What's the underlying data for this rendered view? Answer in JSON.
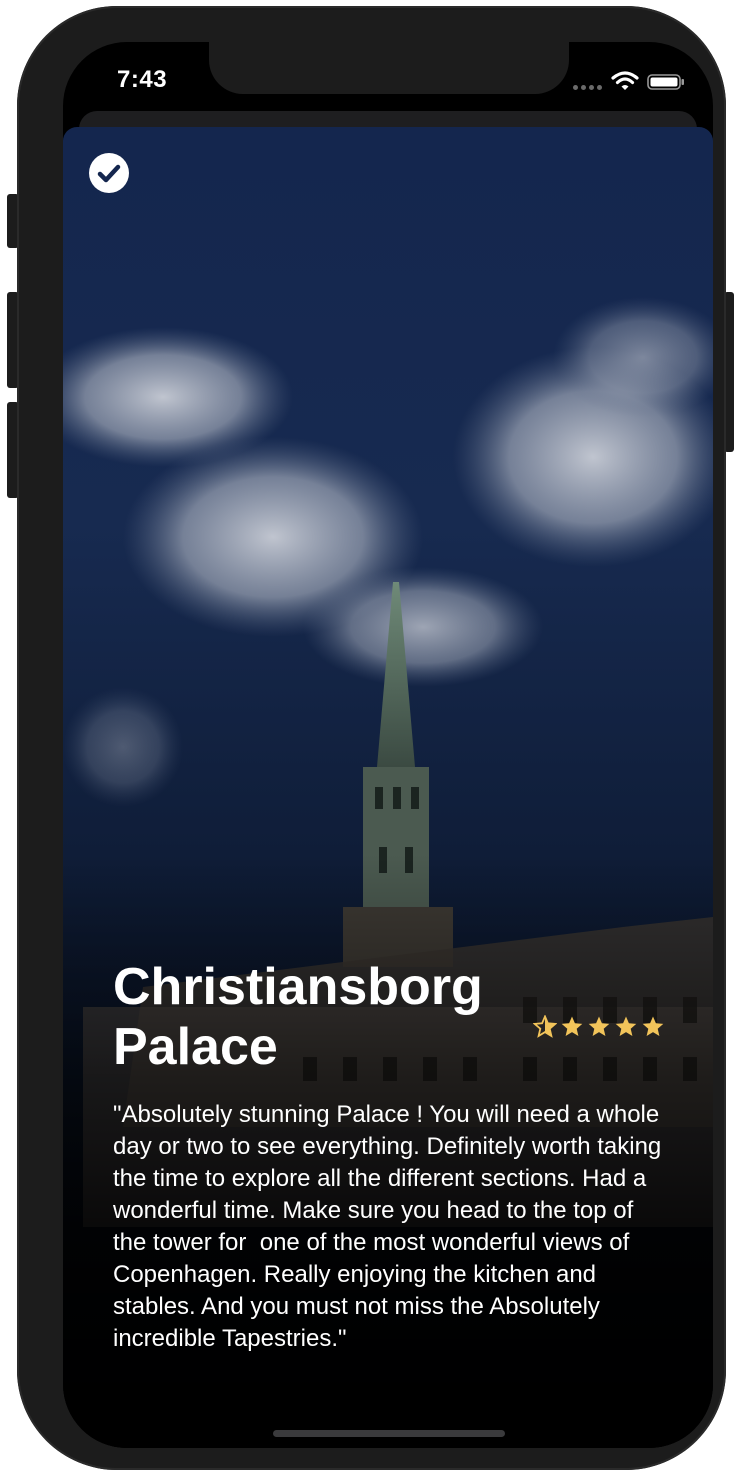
{
  "status_bar": {
    "time": "7:43"
  },
  "place": {
    "title": "Christiansborg Palace",
    "rating_stars": 5,
    "review": "\"Absolutely stunning Palace ! You will need a whole day or two to see everything. Definitely worth taking the time to explore all the different sections. Had a wonderful time. Make sure you head to the top of the tower for  one of the most wonderful views of Copenhagen. Really enjoying the kitchen and stables. And you must not miss the Absolutely incredible Tapestries.\""
  },
  "colors": {
    "star": "#f2c45a",
    "sky_top": "#14264e",
    "text": "#ffffff"
  },
  "icons": {
    "check": "checkmark-circle-icon",
    "signal": "cellular-signal-icon",
    "wifi": "wifi-icon",
    "battery": "battery-icon",
    "star": "star-icon"
  }
}
